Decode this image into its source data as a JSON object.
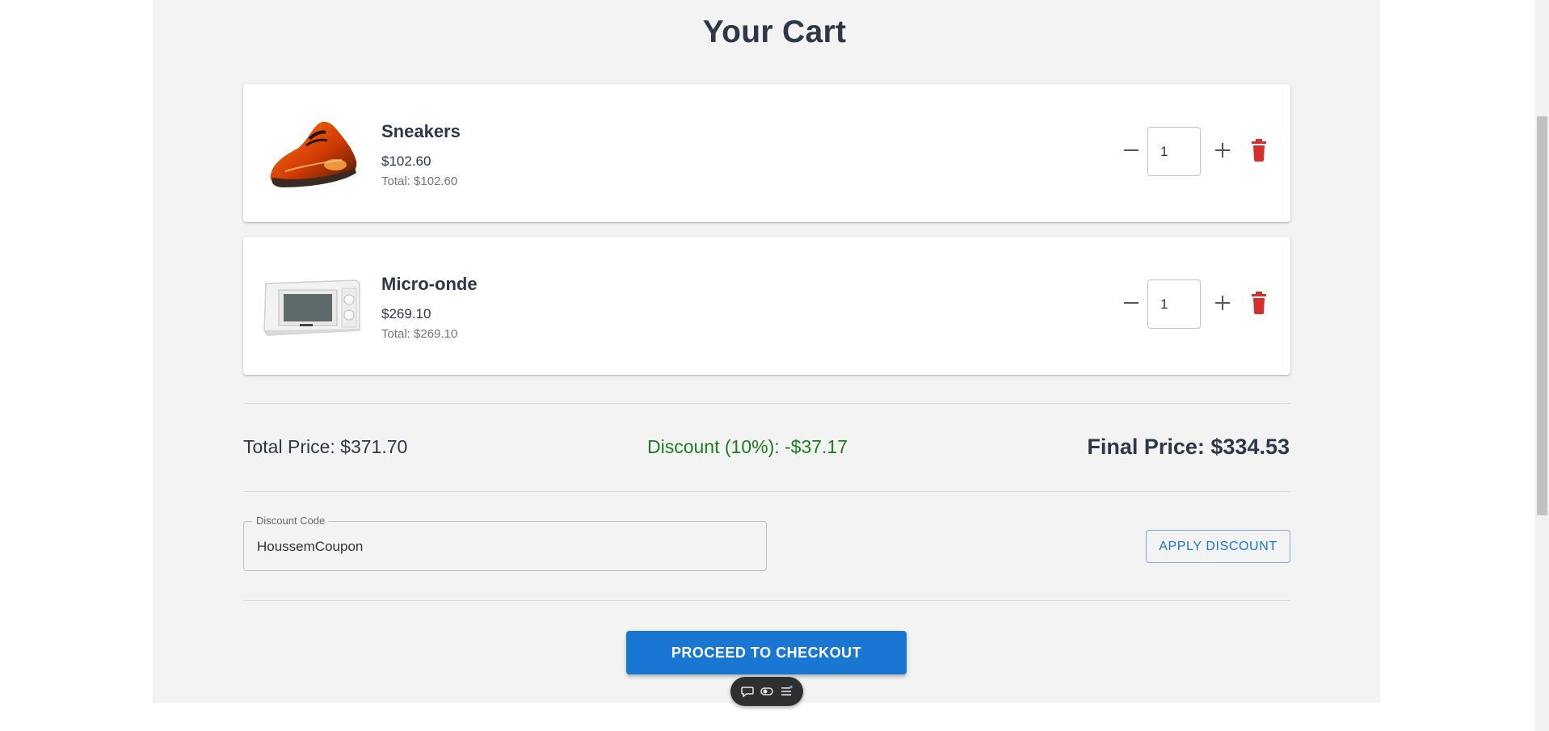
{
  "page": {
    "title": "Your Cart"
  },
  "cart": {
    "items": [
      {
        "name": "Sneakers",
        "price": "$102.60",
        "line_total": "Total: $102.60",
        "quantity": "1",
        "image_icon": "sneaker-product-image"
      },
      {
        "name": "Micro-onde",
        "price": "$269.10",
        "line_total": "Total: $269.10",
        "quantity": "1",
        "image_icon": "microwave-product-image"
      }
    ]
  },
  "summary": {
    "total": "Total Price: $371.70",
    "discount": "Discount (10%): -$37.17",
    "final": "Final Price: $334.53"
  },
  "discount_code": {
    "label": "Discount Code",
    "value": "HoussemCoupon",
    "apply_label": "APPLY DISCOUNT"
  },
  "checkout": {
    "label": "PROCEED TO CHECKOUT"
  },
  "colors": {
    "primary": "#1976d2",
    "discount_text": "#1e7d1e",
    "delete_icon": "#d32f2f",
    "heading_text": "#2d3748",
    "panel_bg": "#f3f3f3"
  },
  "icons": {
    "minus": "minus-icon",
    "plus": "plus-icon",
    "delete": "trash-icon",
    "toolbar": [
      "chat-bubble-icon",
      "toggle-icon",
      "list-icon"
    ]
  }
}
